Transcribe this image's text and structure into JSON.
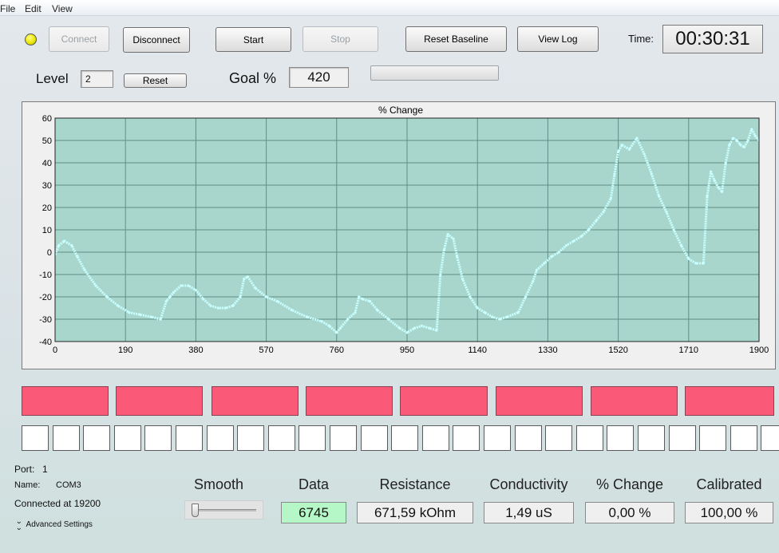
{
  "menu": {
    "file": "File",
    "edit": "Edit",
    "view": "View"
  },
  "toolbar": {
    "connect": "Connect",
    "disconnect": "Disconnect",
    "start": "Start",
    "stop": "Stop",
    "reset_baseline": "Reset Baseline",
    "view_log": "View Log",
    "time_label": "Time:",
    "time_value": "00:30:31",
    "status_led_color": "#e8e400"
  },
  "level": {
    "label": "Level",
    "value": "2",
    "reset": "Reset"
  },
  "goal": {
    "label": "Goal %",
    "value": "420",
    "progress": 0
  },
  "chart_data": {
    "type": "line",
    "title": "% Change",
    "xlabel": "",
    "ylabel": "",
    "xlim": [
      0,
      1900
    ],
    "ylim": [
      -40,
      60
    ],
    "xticks": [
      "0",
      "190",
      "380",
      "570",
      "760",
      "950",
      "1140",
      "1330",
      "1520",
      "1710",
      "1900"
    ],
    "yticks": [
      "60",
      "50",
      "40",
      "30",
      "20",
      "10",
      "0",
      "-10",
      "-20",
      "-30",
      "-40"
    ],
    "grid": true,
    "background": "#a9d6cc",
    "series_color": "#c8ffff",
    "series": [
      {
        "x": [
          0,
          10,
          25,
          45,
          60,
          80,
          110,
          140,
          170,
          200,
          230,
          260,
          285,
          300,
          310,
          320,
          340,
          360,
          380,
          400,
          420,
          440,
          460,
          480,
          500,
          510,
          520,
          540,
          570,
          600,
          640,
          680,
          720,
          740,
          760,
          770,
          790,
          810,
          820,
          830,
          850,
          870,
          900,
          930,
          950,
          970,
          990,
          1010,
          1030,
          1040,
          1050,
          1060,
          1075,
          1085,
          1100,
          1120,
          1140,
          1160,
          1180,
          1200,
          1220,
          1250,
          1270,
          1290,
          1300,
          1320,
          1340,
          1360,
          1380,
          1400,
          1420,
          1440,
          1460,
          1480,
          1500,
          1510,
          1520,
          1530,
          1550,
          1570,
          1590,
          1610,
          1630,
          1650,
          1670,
          1690,
          1710,
          1730,
          1750,
          1760,
          1770,
          1780,
          1790,
          1800,
          1810,
          1820,
          1830,
          1840,
          1850,
          1860,
          1870,
          1880,
          1890,
          1900
        ],
        "y": [
          -1,
          3,
          5,
          3,
          -2,
          -8,
          -15,
          -20,
          -24,
          -27,
          -28,
          -29,
          -30,
          -22,
          -20,
          -18,
          -15,
          -15,
          -17,
          -21,
          -24,
          -25,
          -25,
          -24,
          -20,
          -12,
          -11,
          -16,
          -20,
          -22,
          -26,
          -29,
          -31,
          -33,
          -36,
          -34,
          -30,
          -27,
          -20,
          -21,
          -22,
          -26,
          -30,
          -34,
          -36,
          -34,
          -33,
          -34,
          -35,
          -10,
          1,
          8,
          6,
          -2,
          -12,
          -20,
          -25,
          -27,
          -29,
          -30,
          -29,
          -27,
          -20,
          -13,
          -8,
          -5,
          -2,
          0,
          3,
          5,
          7,
          10,
          14,
          18,
          24,
          35,
          45,
          48,
          46,
          51,
          44,
          35,
          25,
          18,
          10,
          3,
          -3,
          -5,
          -5,
          25,
          36,
          32,
          29,
          27,
          40,
          48,
          51,
          50,
          48,
          47,
          50,
          55,
          52,
          50
        ]
      }
    ]
  },
  "indicators": {
    "bar_count": 8,
    "square_count": 25,
    "bar_color": "#fa5a77"
  },
  "port": {
    "port_label": "Port:",
    "port_value": "1",
    "name_label": "Name:",
    "name_value": "COM3",
    "connected_text": "Connected at 19200",
    "advanced": "Advanced Settings"
  },
  "meters": {
    "smooth_label": "Smooth",
    "smooth_value": 0,
    "data_label": "Data",
    "data_value": "6745",
    "resistance_label": "Resistance",
    "resistance_value": "671,59 kOhm",
    "conductivity_label": "Conductivity",
    "conductivity_value": "1,49 uS",
    "pct_change_label": "% Change",
    "pct_change_value": "0,00 %",
    "calibrated_label": "Calibrated",
    "calibrated_value": "100,00 %"
  }
}
